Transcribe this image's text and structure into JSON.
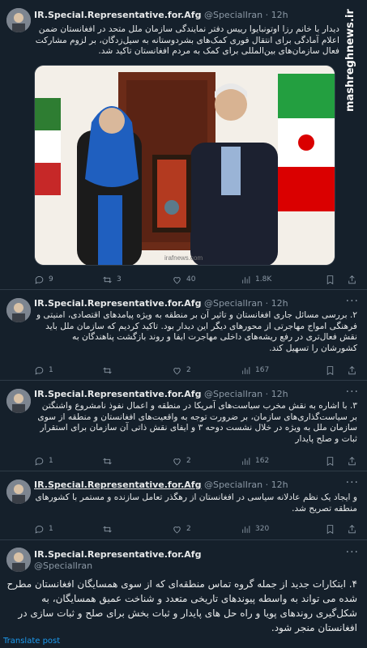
{
  "watermark": "mashreghnews.ir",
  "tweets": [
    {
      "username": "IR.Special.Representative.for.Afg",
      "handle": "@SpecialIran",
      "time": "· 12h",
      "text": "دیدار با خانم رزا اوتونبایوا رییس دفتر نمایندگی سازمان ملل متحد در افغانستان ضمن اعلام آمادگی برای انتقال فوری کمک‌های بشردوستانه به سیل‌زدگان، بر لزوم مشارکت فعال سازمان‌های بین‌المللی برای کمک به مردم افغانستان  تاکید شد.",
      "photo_caption": "irafnews.com",
      "stats": {
        "replies": "9",
        "retweets": "3",
        "likes": "40",
        "views": "1.8K"
      }
    },
    {
      "username": "IR.Special.Representative.for.Afg",
      "handle": "@SpecialIran",
      "time": "· 12h",
      "text": "۲. بررسی مسائل جاری افغانستان و تاثیر آن بر منطقه به ویژه پیامد‌های اقتصادی، امنیتی و فرهنگی امواج مهاجرتی از محور‌های دیگر این دیدار بود. تاکید کردیم که سازمان ملل باید نقش فعال‌تری در رفع ریشه‌های داخلی مهاجرت ایفا و روند بازگشت پناهندگان به کشورشان را تسهیل کند.",
      "stats": {
        "replies": "1",
        "retweets": "",
        "likes": "2",
        "views": "167"
      }
    },
    {
      "username": "IR.Special.Representative.for.Afg",
      "handle": "@SpecialIran",
      "time": "· 12h",
      "text": "۳. با اشاره به نقش مخرب سیاست‌های آمریکا در منطقه و اعمال نفوذ نامشروع واشنگتن بر سیاست‌گذاری‌های سازمان، بر ضرورت توجه به واقعیت‌های افغانستان و منطقه از سوی سازمان ملل به ویژه در خلال نشست دوحه ۳ و ایفای نقش ذاتی آن سازمان برای استقرار ثبات و صلح پایدار",
      "stats": {
        "replies": "1",
        "retweets": "",
        "likes": "2",
        "views": "162"
      }
    },
    {
      "username": "IR.Special.Representative.for.Afg",
      "handle": "@SpecialIran",
      "time": "· 12h",
      "text": "و ایجاد یک نظم عادلانه سیاسی در افغانستان از رهگذر تعامل سازنده و مستمر با کشورهای منطقه تصریح شد.",
      "stats": {
        "replies": "1",
        "retweets": "",
        "likes": "2",
        "views": "320"
      }
    },
    {
      "username": "IR.Special.Representative.for.Afg",
      "handle": "@SpecialIran",
      "time": "",
      "text": "۴. ابتکارات جدید از جمله گروه تماس منطقه‌ای که از سوی همسایگان افغانستان مطرح شده می تواند به واسطه پیوندهای تاریخی متعدد و شناخت عمیق همسایگان، به شکل‌گیری روندهای پویا و راه حل های پایدار و ثبات بخش برای صلح و ثبات سازی در افغانستان منجر شود.",
      "translate": "Translate post"
    }
  ]
}
